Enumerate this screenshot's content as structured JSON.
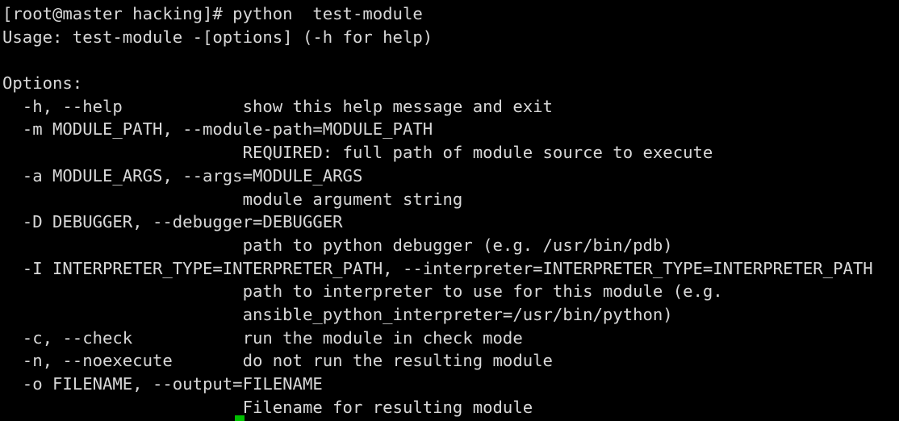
{
  "terminal": {
    "lines": [
      "[root@master hacking]# python  test-module",
      "Usage: test-module -[options] (-h for help)",
      "",
      "Options:",
      "  -h, --help            show this help message and exit",
      "  -m MODULE_PATH, --module-path=MODULE_PATH",
      "                        REQUIRED: full path of module source to execute",
      "  -a MODULE_ARGS, --args=MODULE_ARGS",
      "                        module argument string",
      "  -D DEBUGGER, --debugger=DEBUGGER",
      "                        path to python debugger (e.g. /usr/bin/pdb)",
      "  -I INTERPRETER_TYPE=INTERPRETER_PATH, --interpreter=INTERPRETER_TYPE=INTERPRETER_PATH",
      "                        path to interpreter to use for this module (e.g.",
      "                        ansible_python_interpreter=/usr/bin/python)",
      "  -c, --check           run the module in check mode",
      "  -n, --noexecute       do not run the resulting module",
      "  -o FILENAME, --output=FILENAME",
      "                        Filename for resulting module"
    ]
  },
  "colors": {
    "background": "#000000",
    "text": "#d8d8d8",
    "cursor": "#00c000"
  }
}
